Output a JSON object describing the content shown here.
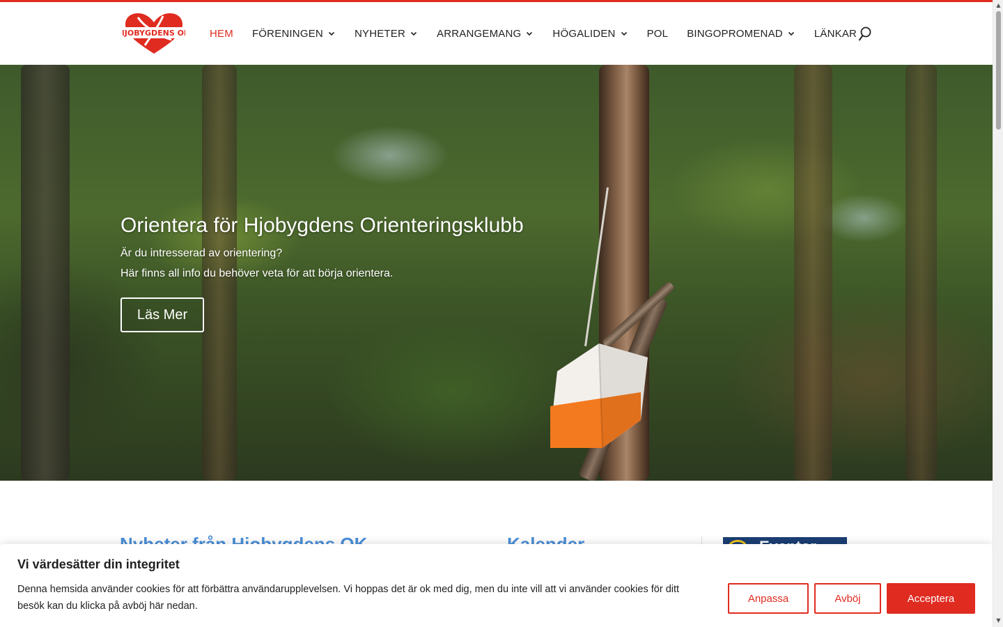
{
  "brand": {
    "logo_text": "HJOBYGDENS OK",
    "accent": "#e02b20",
    "link_blue": "#4a8fd8"
  },
  "nav": {
    "items": [
      {
        "label": "HEM",
        "active": true,
        "has_dropdown": false
      },
      {
        "label": "FÖRENINGEN",
        "active": false,
        "has_dropdown": true
      },
      {
        "label": "NYHETER",
        "active": false,
        "has_dropdown": true
      },
      {
        "label": "ARRANGEMANG",
        "active": false,
        "has_dropdown": true
      },
      {
        "label": "HÖGALIDEN",
        "active": false,
        "has_dropdown": true
      },
      {
        "label": "POL",
        "active": false,
        "has_dropdown": false
      },
      {
        "label": "BINGOPROMENAD",
        "active": false,
        "has_dropdown": true
      },
      {
        "label": "LÄNKAR",
        "active": false,
        "has_dropdown": false
      }
    ],
    "search_icon": "search-icon"
  },
  "hero": {
    "title": "Orientera för Hjobygdens Orienteringsklubb",
    "line1": "Är du intresserad av orientering?",
    "line2": "Här finns all info du behöver veta för att börja orientera.",
    "button": "Läs Mer"
  },
  "sections": {
    "news_title": "Nyheter från Hjobygdens OK",
    "calendar_title": "Kalender",
    "eventor_label": "Eventor"
  },
  "cookie": {
    "title": "Vi värdesätter din integritet",
    "text": "Denna hemsida använder cookies för att förbättra användarupplevelsen. Vi hoppas det är ok med dig, men du inte vill att vi använder cookies för ditt besök kan du klicka på avböj här nedan.",
    "customize": "Anpassa",
    "reject": "Avböj",
    "accept": "Acceptera"
  }
}
